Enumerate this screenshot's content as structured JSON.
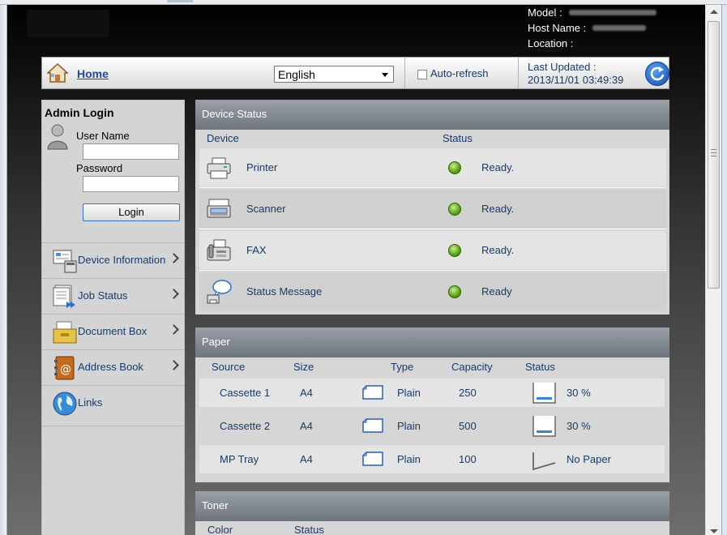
{
  "header": {
    "model_label": "Model :",
    "host_label": "Host Name :",
    "location_label": "Location :"
  },
  "topbar": {
    "home": "Home",
    "language": "English",
    "auto_refresh": "Auto-refresh",
    "last_updated_label": "Last Updated :",
    "last_updated_value": "2013/11/01 03:49:39"
  },
  "admin": {
    "title": "Admin Login",
    "username_label": "User Name",
    "password_label": "Password",
    "login_button": "Login"
  },
  "nav": [
    {
      "label": "Device Information",
      "icon": "device-info-icon",
      "chevron": true
    },
    {
      "label": "Job Status",
      "icon": "job-status-icon",
      "chevron": true
    },
    {
      "label": "Document Box",
      "icon": "document-box-icon",
      "chevron": true
    },
    {
      "label": "Address Book",
      "icon": "address-book-icon",
      "chevron": true
    },
    {
      "label": "Links",
      "icon": "globe-icon",
      "chevron": false
    }
  ],
  "device_status": {
    "title": "Device Status",
    "col_device": "Device",
    "col_status": "Status",
    "rows": [
      {
        "name": "Printer",
        "status": "Ready.",
        "icon": "printer-icon"
      },
      {
        "name": "Scanner",
        "status": "Ready.",
        "icon": "scanner-icon"
      },
      {
        "name": "FAX",
        "status": "Ready.",
        "icon": "fax-icon"
      },
      {
        "name": "Status Message",
        "status": "Ready",
        "icon": "status-message-icon"
      }
    ]
  },
  "paper": {
    "title": "Paper",
    "columns": [
      "Source",
      "Size",
      "Type",
      "Capacity",
      "Status"
    ],
    "rows": [
      {
        "source": "Cassette 1",
        "size": "A4",
        "type": "Plain",
        "capacity": "250",
        "status": "30 %",
        "level": 0.3
      },
      {
        "source": "Cassette 2",
        "size": "A4",
        "type": "Plain",
        "capacity": "500",
        "status": "30 %",
        "level": 0.3
      },
      {
        "source": "MP Tray",
        "size": "A4",
        "type": "Plain",
        "capacity": "100",
        "status": "No Paper",
        "level": 0
      }
    ]
  },
  "toner": {
    "title": "Toner",
    "col_color": "Color",
    "col_status": "Status"
  },
  "colors": {
    "accent_text": "#1a3a6a",
    "link": "#1c4aa8",
    "status_ok": "#5aa018"
  }
}
